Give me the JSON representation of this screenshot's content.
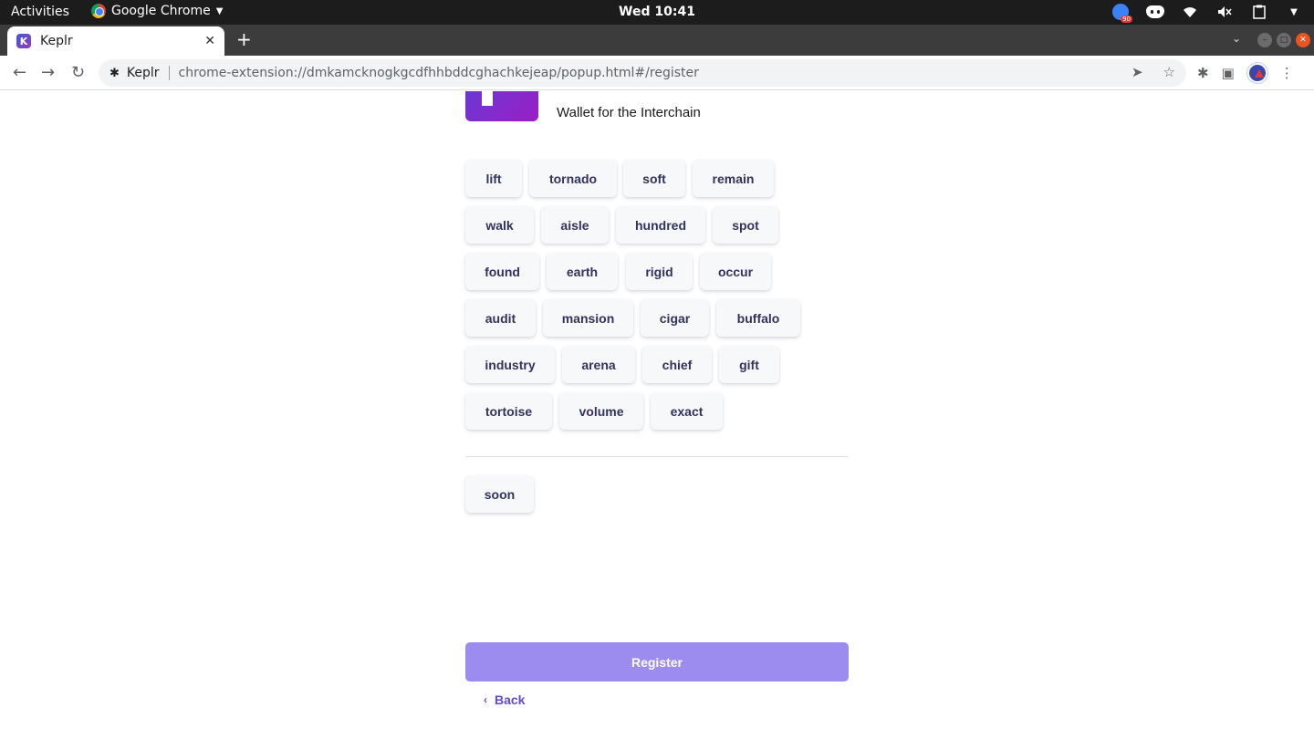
{
  "system_bar": {
    "activities": "Activities",
    "app_name": "Google Chrome",
    "clock": "Wed 10:41",
    "notification_badge": "90"
  },
  "browser": {
    "tab_title": "Keplr",
    "tab_favicon_letter": "K",
    "address_site": "Keplr",
    "address_url": "chrome-extension://dmkamcknogkgcdfhhbddcghachkejeap/popup.html#/register"
  },
  "page": {
    "tagline": "Wallet for the Interchain",
    "mnemonic_words": [
      "lift",
      "tornado",
      "soft",
      "remain",
      "walk",
      "aisle",
      "hundred",
      "spot",
      "found",
      "earth",
      "rigid",
      "occur",
      "audit",
      "mansion",
      "cigar",
      "buffalo",
      "industry",
      "arena",
      "chief",
      "gift",
      "tortoise",
      "volume",
      "exact"
    ],
    "selected_words": [
      "soon"
    ],
    "register_label": "Register",
    "back_label": "Back",
    "accent_color": "#9d8cef",
    "link_color": "#5e4bd6"
  }
}
